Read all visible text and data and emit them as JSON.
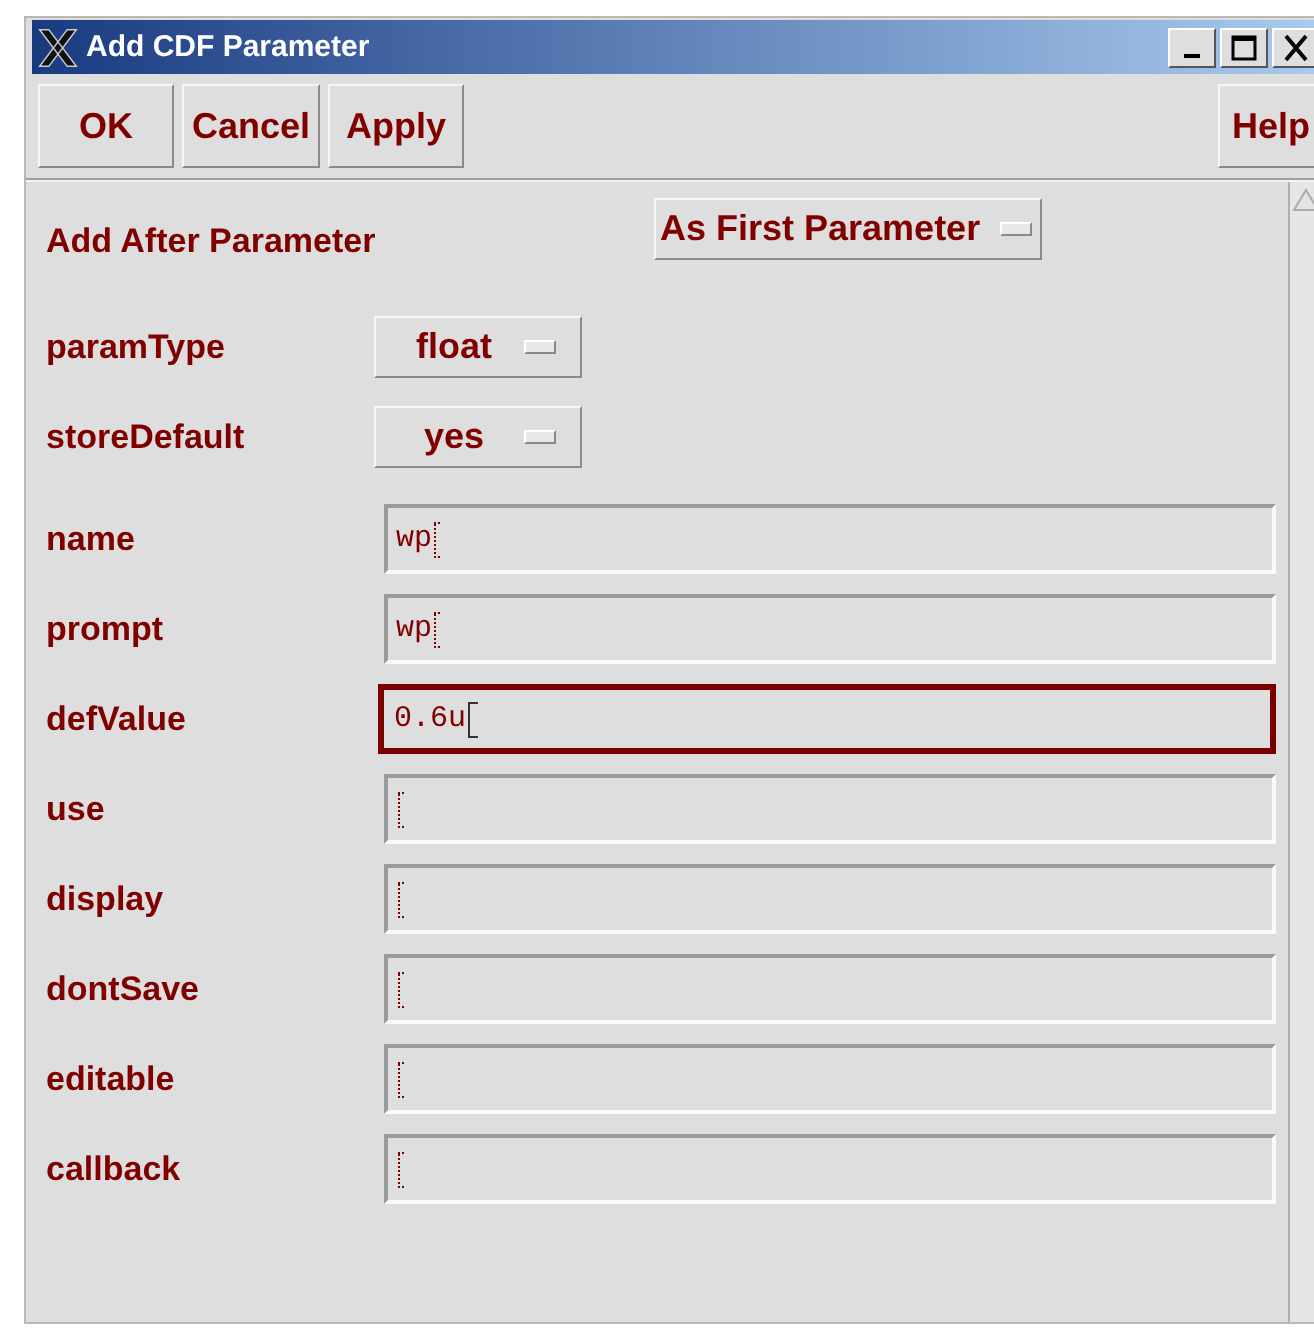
{
  "window": {
    "title": "Add CDF Parameter"
  },
  "toolbar": {
    "buttons": [
      {
        "label": "OK"
      },
      {
        "label": "Cancel"
      },
      {
        "label": "Apply"
      }
    ],
    "help": "Help"
  },
  "form": {
    "fields": [
      {
        "label": "Add After Parameter",
        "kind": "choice",
        "value": "As First Parameter"
      },
      {
        "label": "paramType",
        "kind": "choice",
        "value": "float"
      },
      {
        "label": "storeDefault",
        "kind": "choice",
        "value": "yes"
      },
      {
        "label": "name",
        "kind": "text",
        "value": "wp",
        "focused": false
      },
      {
        "label": "prompt",
        "kind": "text",
        "value": "wp",
        "focused": false
      },
      {
        "label": "defValue",
        "kind": "text",
        "value": "0.6u",
        "focused": true
      },
      {
        "label": "use",
        "kind": "text",
        "focused": false
      },
      {
        "label": "display",
        "kind": "text",
        "focused": false
      },
      {
        "label": "dontSave",
        "kind": "text",
        "focused": false
      },
      {
        "label": "editable",
        "kind": "text",
        "focused": false
      },
      {
        "label": "callback",
        "kind": "text",
        "focused": false
      }
    ]
  }
}
